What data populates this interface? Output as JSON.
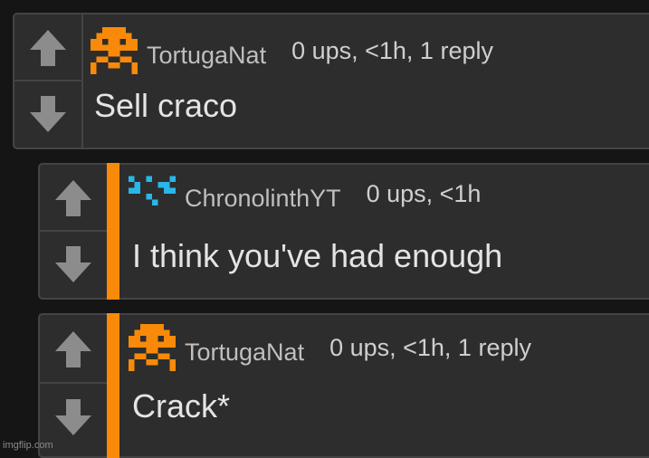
{
  "colors": {
    "background": "#151515",
    "card": "#2d2d2d",
    "border": "#444444",
    "accent": "#f98a09",
    "vote_arrow": "#8c8c8c",
    "avatar_orange": "#f98a09",
    "avatar_cyan": "#29b6e8"
  },
  "icons": {
    "upvote": "arrow-up-icon",
    "downvote": "arrow-down-icon"
  },
  "comments": [
    {
      "username": "TortugaNat",
      "meta": "0 ups, <1h, 1 reply",
      "text": "Sell craco",
      "avatar": "orange-pixel-invader-avatar"
    },
    {
      "username": "ChronolinthYT",
      "meta": "0 ups, <1h",
      "text": "I think you've had enough",
      "avatar": "cyan-pixel-pattern-avatar"
    },
    {
      "username": "TortugaNat",
      "meta": "0 ups, <1h, 1 reply",
      "text": "Crack*",
      "avatar": "orange-pixel-invader-avatar"
    }
  ],
  "watermark": "imgflip.com"
}
